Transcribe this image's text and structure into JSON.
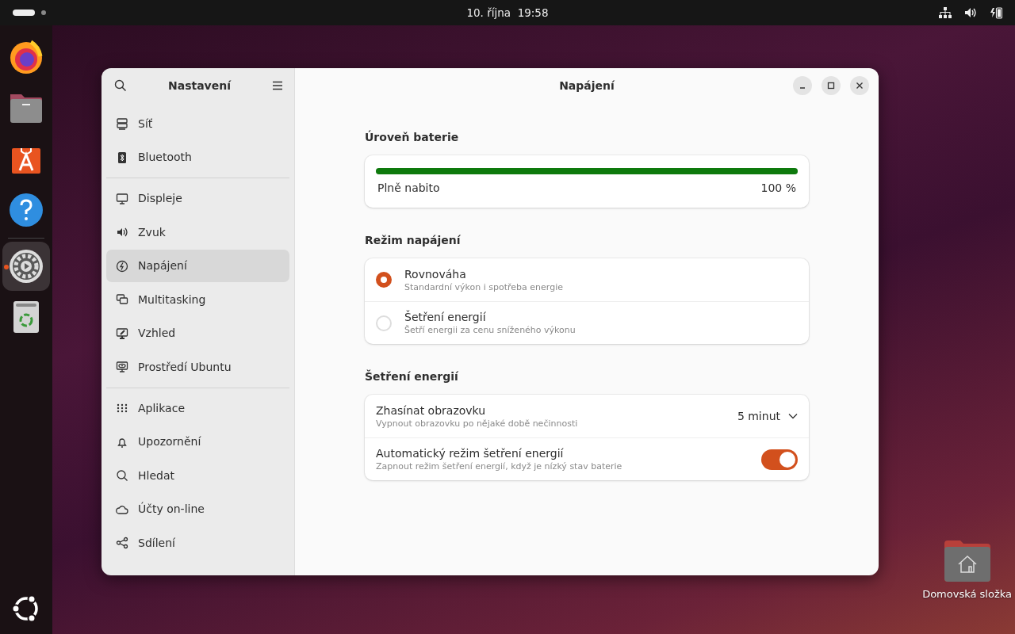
{
  "top_bar": {
    "date": "10. října",
    "time": "19:58"
  },
  "dock": {
    "items": [
      {
        "kind": "firefox",
        "running": false,
        "selected": false
      },
      {
        "kind": "files",
        "running": false,
        "selected": false
      },
      {
        "kind": "store",
        "running": false,
        "selected": false
      },
      {
        "kind": "help",
        "running": false,
        "selected": false
      },
      {
        "kind": "settings",
        "running": true,
        "selected": true
      },
      {
        "kind": "trash",
        "running": false,
        "selected": false
      }
    ]
  },
  "window": {
    "sidebar": {
      "title": "Nastavení",
      "groups": [
        [
          {
            "kind": "network",
            "label": "Síť",
            "selected": false
          },
          {
            "kind": "bluetooth",
            "label": "Bluetooth",
            "selected": false
          }
        ],
        [
          {
            "kind": "display",
            "label": "Displeje",
            "selected": false
          },
          {
            "kind": "sound",
            "label": "Zvuk",
            "selected": false
          },
          {
            "kind": "power",
            "label": "Napájení",
            "selected": true
          },
          {
            "kind": "multitasking",
            "label": "Multitasking",
            "selected": false
          },
          {
            "kind": "appearance",
            "label": "Vzhled",
            "selected": false
          },
          {
            "kind": "desktop",
            "label": "Prostředí Ubuntu",
            "selected": false
          }
        ],
        [
          {
            "kind": "apps",
            "label": "Aplikace",
            "selected": false
          },
          {
            "kind": "bell",
            "label": "Upozornění",
            "selected": false
          },
          {
            "kind": "search",
            "label": "Hledat",
            "selected": false
          },
          {
            "kind": "cloud",
            "label": "Účty on-line",
            "selected": false
          },
          {
            "kind": "share",
            "label": "Sdílení",
            "selected": false
          }
        ]
      ]
    },
    "title": "Napájení",
    "battery": {
      "heading": "Úroveň baterie",
      "level": 1,
      "status": "Plně nabito",
      "percent": "100 %"
    },
    "power_mode": {
      "heading": "Režim napájení",
      "options": [
        {
          "title": "Rovnováha",
          "subtitle": "Standardní výkon i spotřeba energie",
          "selected": true
        },
        {
          "title": "Šetření energií",
          "subtitle": "Šetří energii za cenu sníženého výkonu",
          "selected": false
        }
      ]
    },
    "power_saving": {
      "heading": "Šetření energií",
      "rows": [
        {
          "kind": "dropdown",
          "title": "Zhasínat obrazovku",
          "subtitle": "Vypnout obrazovku po nějaké době nečinnosti",
          "value": "5 minut"
        },
        {
          "kind": "switch",
          "title": "Automatický režim šetření energií",
          "subtitle": "Zapnout režim šetření energií, když je nízký stav baterie",
          "on": true
        }
      ]
    }
  },
  "desktop_icon": {
    "label": "Domovská složka"
  }
}
